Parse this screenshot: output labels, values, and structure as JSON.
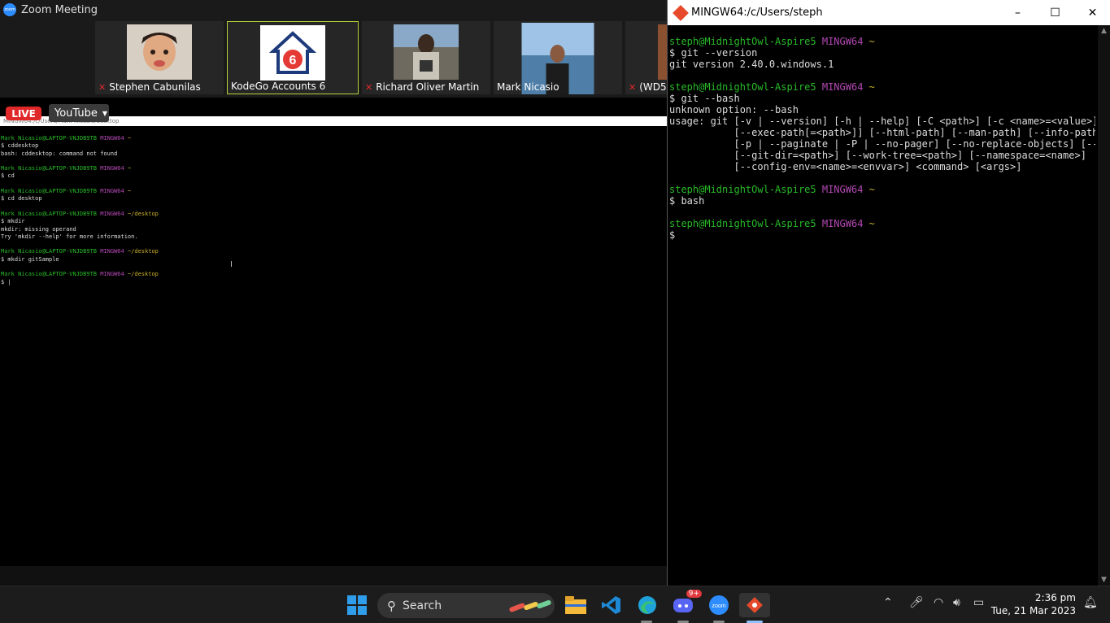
{
  "zoom": {
    "title": "Zoom Meeting",
    "participants": [
      {
        "name": "Stephen Cabunilas",
        "muted": true
      },
      {
        "name": "KodeGo Accounts 6",
        "muted": false,
        "active": true
      },
      {
        "name": "Richard Oliver Martin",
        "muted": true
      },
      {
        "name": "Mark Nicasio",
        "muted": false
      },
      {
        "name": "(WD5",
        "muted": true
      }
    ],
    "live_label": "LIVE",
    "stream_label": "YouTube"
  },
  "shared_screen": {
    "path_bar": "MINGW64:/c/Users/Mark Nicasio/desktop",
    "lines": [
      {
        "prompt_user": "Mark Nicasio@LAPTOP-VNJDB9TB",
        "prompt_env": "MINGW64",
        "prompt_dir": "~"
      },
      {
        "text": "$ cddesktop"
      },
      {
        "text": "bash: cddesktop: command not found"
      },
      {
        "text": ""
      },
      {
        "prompt_user": "Mark Nicasio@LAPTOP-VNJDB9TB",
        "prompt_env": "MINGW64",
        "prompt_dir": "~"
      },
      {
        "text": "$ cd"
      },
      {
        "text": ""
      },
      {
        "prompt_user": "Mark Nicasio@LAPTOP-VNJDB9TB",
        "prompt_env": "MINGW64",
        "prompt_dir": "~"
      },
      {
        "text": "$ cd desktop"
      },
      {
        "text": ""
      },
      {
        "prompt_user": "Mark Nicasio@LAPTOP-VNJDB9TB",
        "prompt_env": "MINGW64",
        "prompt_dir": "~/desktop"
      },
      {
        "text": "$ mkdir"
      },
      {
        "text": "mkdir: missing operand"
      },
      {
        "text": "Try 'mkdir --help' for more information."
      },
      {
        "text": ""
      },
      {
        "prompt_user": "Mark Nicasio@LAPTOP-VNJDB9TB",
        "prompt_env": "MINGW64",
        "prompt_dir": "~/desktop"
      },
      {
        "text": "$ mkdir gitSample"
      },
      {
        "text": ""
      },
      {
        "prompt_user": "Mark Nicasio@LAPTOP-VNJDB9TB",
        "prompt_env": "MINGW64",
        "prompt_dir": "~/desktop"
      },
      {
        "text": "$ |"
      }
    ]
  },
  "git_window": {
    "title": "MINGW64:/c/Users/steph",
    "lines": [
      {
        "prompt_user": "steph@MidnightOwl-Aspire5",
        "prompt_env": "MINGW64",
        "prompt_dir": "~"
      },
      {
        "text": "$ git --version"
      },
      {
        "text": "git version 2.40.0.windows.1"
      },
      {
        "text": ""
      },
      {
        "prompt_user": "steph@MidnightOwl-Aspire5",
        "prompt_env": "MINGW64",
        "prompt_dir": "~"
      },
      {
        "text": "$ git --bash"
      },
      {
        "text": "unknown option: --bash"
      },
      {
        "text": "usage: git [-v | --version] [-h | --help] [-C <path>] [-c <name>=<value>]"
      },
      {
        "text": "           [--exec-path[=<path>]] [--html-path] [--man-path] [--info-path]"
      },
      {
        "text": "           [-p | --paginate | -P | --no-pager] [--no-replace-objects] [--ba"
      },
      {
        "text": "           [--git-dir=<path>] [--work-tree=<path>] [--namespace=<name>]"
      },
      {
        "text": "           [--config-env=<name>=<envvar>] <command> [<args>]"
      },
      {
        "text": ""
      },
      {
        "prompt_user": "steph@MidnightOwl-Aspire5",
        "prompt_env": "MINGW64",
        "prompt_dir": "~"
      },
      {
        "text": "$ bash"
      },
      {
        "text": ""
      },
      {
        "prompt_user": "steph@MidnightOwl-Aspire5",
        "prompt_env": "MINGW64",
        "prompt_dir": "~"
      },
      {
        "text": "$"
      }
    ]
  },
  "taskbar": {
    "search_label": "Search",
    "discord_badge": "9+",
    "time": "2:36 pm",
    "date": "Tue, 21 Mar 2023"
  }
}
